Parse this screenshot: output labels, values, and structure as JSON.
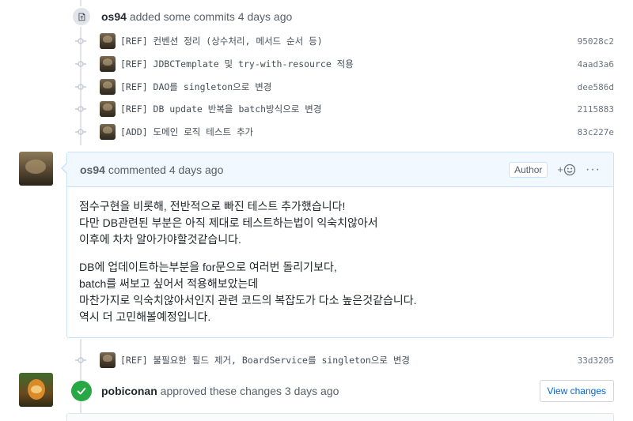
{
  "commit_event": {
    "author": "os94",
    "text": "added some commits",
    "time": "4 days ago"
  },
  "commits": [
    {
      "message": "[REF] 컨벤션 정리 (상수처리, 메서드 순서 등)",
      "sha": "95028c2"
    },
    {
      "message": "[REF] JDBCTemplate 및 try-with-resource 적용",
      "sha": "4aad3a6"
    },
    {
      "message": "[REF] DAO를 singleton으로 변경",
      "sha": "dee586d"
    },
    {
      "message": "[REF] DB update 반복을 batch방식으로 변경",
      "sha": "2115883"
    },
    {
      "message": "[ADD] 도메인 로직 테스트 추가",
      "sha": "83c227e"
    }
  ],
  "comment": {
    "author": "os94",
    "action": "commented",
    "time": "4 days ago",
    "author_label": "Author",
    "reaction_label": "+",
    "more_label": "···",
    "paragraphs": [
      [
        "점수구현을 비롯해, 전반적으로 빠진 테스트 추가했습니다!",
        "다만 DB관련된 부분은 아직 제대로 테스트하는법이 익숙치않아서",
        "이후에 차차 알아가야할것같습니다."
      ],
      [
        "DB에 업데이트하는부분을 for문으로 여러번 돌리기보다,",
        "batch를 써보고 싶어서 적용해보았는데",
        "마찬가지로 익숙치않아서인지 관련 코드의 복잡도가 다소 높은것같습니다.",
        "역시 더 고민해볼예정입니다."
      ]
    ]
  },
  "later_commit": {
    "message": "[REF] 불필요한 필드 제거, BoardService를 singleton으로 변경",
    "sha": "33d3205"
  },
  "review": {
    "author": "pobiconan",
    "text": "approved these changes",
    "time": "3 days ago",
    "button": "View changes"
  },
  "icons": {
    "commit_event": "repo-push-icon",
    "commit_dot": "git-commit-icon",
    "reaction": "smiley-icon",
    "approve": "check-icon"
  },
  "colors": {
    "link": "#0366d6",
    "approve_green": "#28a745",
    "comment_border": "#c8e1ff",
    "comment_header_bg": "#f1f8ff"
  }
}
